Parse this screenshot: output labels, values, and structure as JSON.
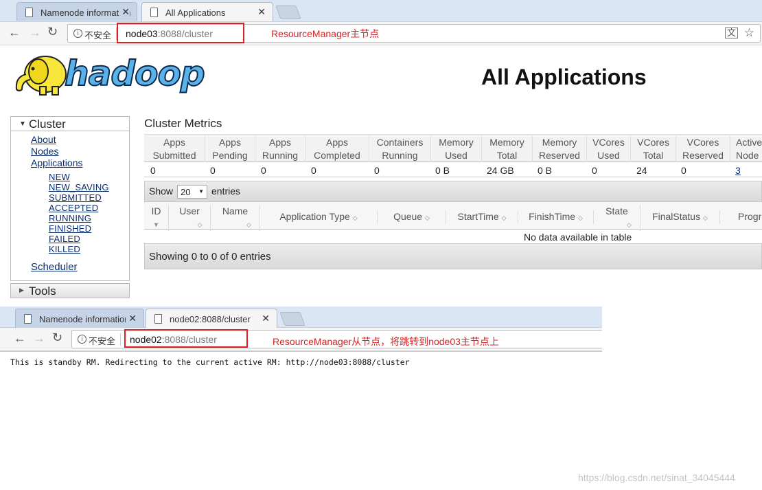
{
  "window1": {
    "tabs": [
      {
        "label": "Namenode information",
        "active": false
      },
      {
        "label": "All Applications",
        "active": true
      }
    ],
    "security_label": "不安全",
    "url_host": "node03",
    "url_rest": ":8088/cluster",
    "annotation": "ResourceManager主节点"
  },
  "page": {
    "title": "All Applications",
    "sidebar": {
      "cluster_label": "Cluster",
      "links": [
        "About",
        "Nodes",
        "Applications"
      ],
      "app_states": [
        "NEW",
        "NEW_SAVING",
        "SUBMITTED",
        "ACCEPTED",
        "RUNNING",
        "FINISHED",
        "FAILED",
        "KILLED"
      ],
      "scheduler_label": "Scheduler",
      "tools_label": "Tools"
    },
    "metrics": {
      "caption": "Cluster Metrics",
      "headers": [
        [
          "Apps",
          "Submitted"
        ],
        [
          "Apps",
          "Pending"
        ],
        [
          "Apps",
          "Running"
        ],
        [
          "Apps",
          "Completed"
        ],
        [
          "Containers",
          "Running"
        ],
        [
          "Memory",
          "Used"
        ],
        [
          "Memory",
          "Total"
        ],
        [
          "Memory",
          "Reserved"
        ],
        [
          "VCores",
          "Used"
        ],
        [
          "VCores",
          "Total"
        ],
        [
          "VCores",
          "Reserved"
        ],
        [
          "Active",
          "Node"
        ]
      ],
      "values": [
        "0",
        "0",
        "0",
        "0",
        "0",
        "0 B",
        "24 GB",
        "0 B",
        "0",
        "24",
        "0",
        "3"
      ]
    },
    "table": {
      "show_label": "Show",
      "entries_value": "20",
      "entries_label": "entries",
      "columns": [
        [
          "ID",
          ""
        ],
        [
          "User",
          ""
        ],
        [
          "Name",
          ""
        ],
        [
          "Application Type",
          ""
        ],
        [
          "Queue",
          ""
        ],
        [
          "StartTime",
          ""
        ],
        [
          "FinishTime",
          ""
        ],
        [
          "State",
          ""
        ],
        [
          "FinalStatus",
          ""
        ],
        [
          "Progr",
          ""
        ]
      ],
      "empty_message": "No data available in table",
      "footer": "Showing 0 to 0 of 0 entries"
    }
  },
  "window2": {
    "tabs": [
      {
        "label": "Namenode information",
        "active": false
      },
      {
        "label": "node02:8088/cluster",
        "active": true
      }
    ],
    "security_label": "不安全",
    "url_host": "node02",
    "url_rest": ":8088/cluster",
    "annotation": "ResourceManager从节点，将跳转到node03主节点上",
    "body_text": "This is standby RM. Redirecting to the current active RM: http://node03:8088/cluster"
  },
  "watermark": "https://blog.csdn.net/sinat_34045444",
  "colors": {
    "annotation": "#e02020",
    "link": "#0a2d72",
    "logo": "#5ab2e8"
  }
}
